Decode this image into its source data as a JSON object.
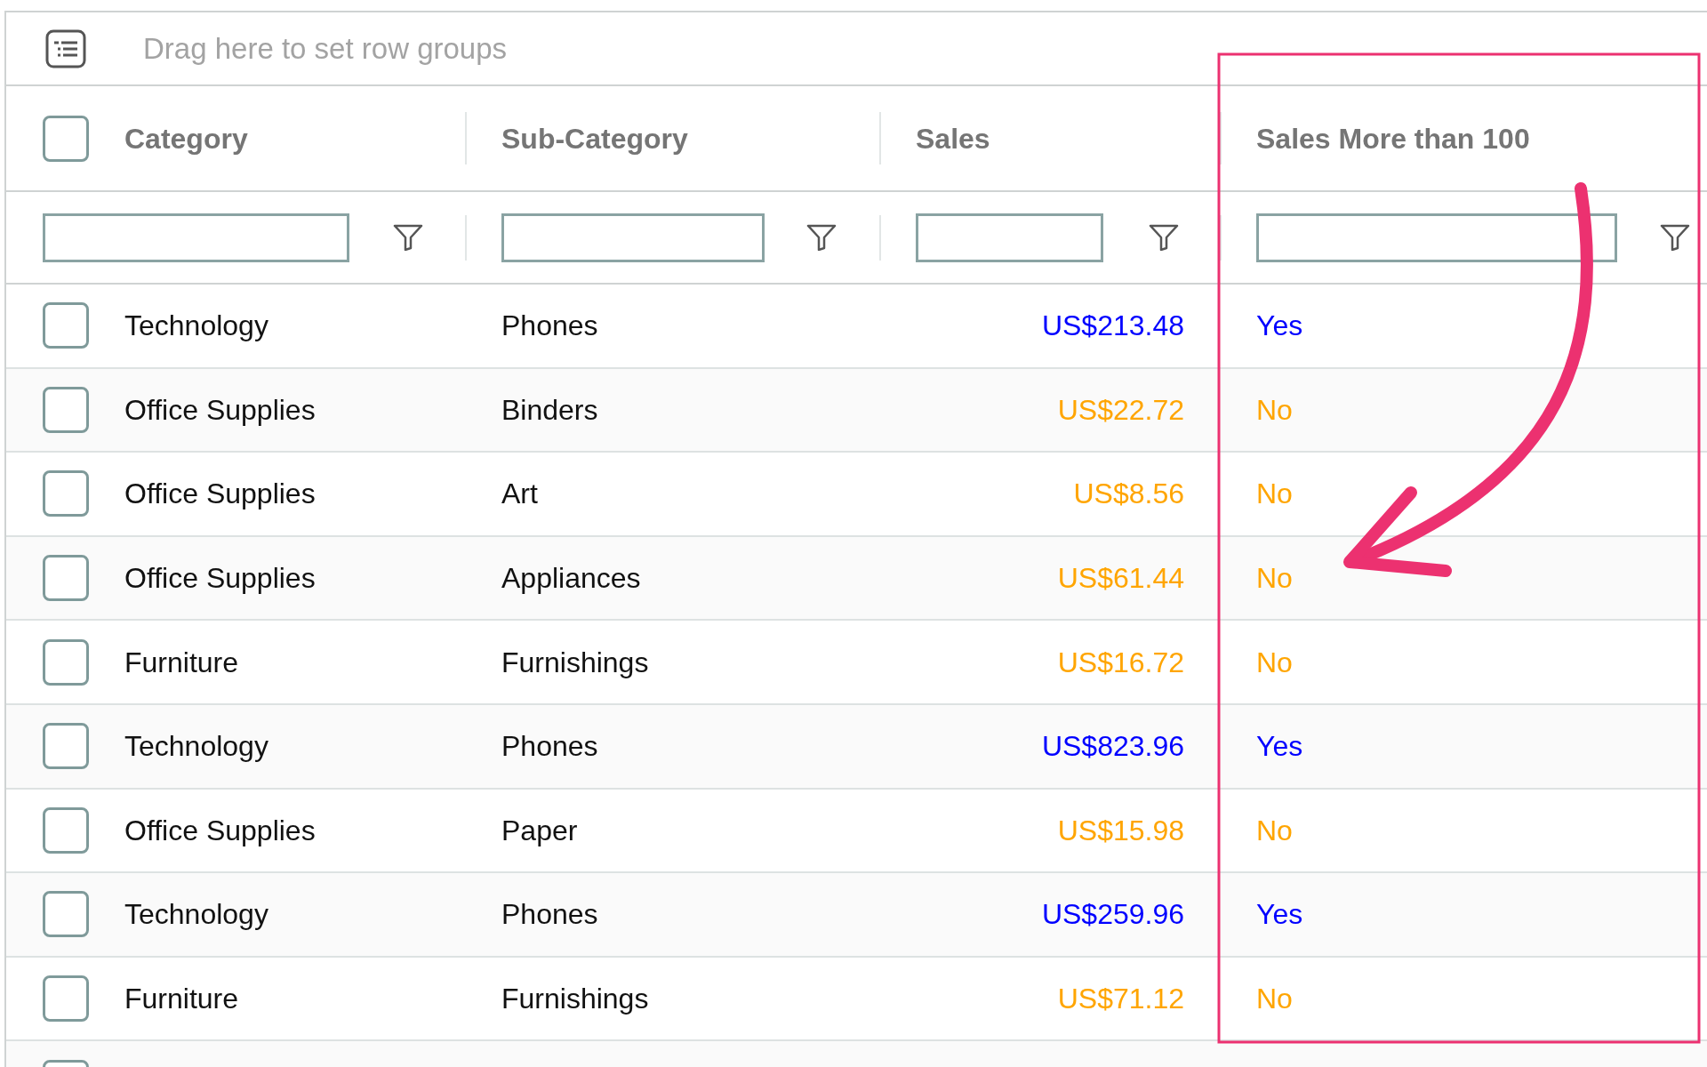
{
  "group_bar": {
    "placeholder": "Drag here to set row groups"
  },
  "header": {
    "checked": false,
    "columns": [
      "Category",
      "Sub-Category",
      "Sales",
      "Sales More than 100"
    ]
  },
  "rows": [
    {
      "checked": false,
      "category": "Technology",
      "sub_category": "Phones",
      "sales": "US$213.48",
      "more_than_100": "Yes",
      "color": "#0000ff"
    },
    {
      "checked": false,
      "category": "Office Supplies",
      "sub_category": "Binders",
      "sales": "US$22.72",
      "more_than_100": "No",
      "color": "#ffa500"
    },
    {
      "checked": false,
      "category": "Office Supplies",
      "sub_category": "Art",
      "sales": "US$8.56",
      "more_than_100": "No",
      "color": "#ffa500"
    },
    {
      "checked": false,
      "category": "Office Supplies",
      "sub_category": "Appliances",
      "sales": "US$61.44",
      "more_than_100": "No",
      "color": "#ffa500"
    },
    {
      "checked": false,
      "category": "Furniture",
      "sub_category": "Furnishings",
      "sales": "US$16.72",
      "more_than_100": "No",
      "color": "#ffa500"
    },
    {
      "checked": false,
      "category": "Technology",
      "sub_category": "Phones",
      "sales": "US$823.96",
      "more_than_100": "Yes",
      "color": "#0000ff"
    },
    {
      "checked": false,
      "category": "Office Supplies",
      "sub_category": "Paper",
      "sales": "US$15.98",
      "more_than_100": "No",
      "color": "#ffa500"
    },
    {
      "checked": false,
      "category": "Technology",
      "sub_category": "Phones",
      "sales": "US$259.96",
      "more_than_100": "Yes",
      "color": "#0000ff"
    },
    {
      "checked": false,
      "category": "Furniture",
      "sub_category": "Furnishings",
      "sales": "US$71.12",
      "more_than_100": "No",
      "color": "#ffa500"
    },
    {
      "checked": false
    }
  ]
}
